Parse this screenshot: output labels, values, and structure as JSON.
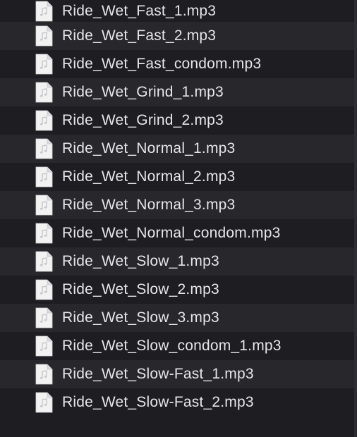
{
  "files": [
    {
      "name": "Ride_Wet_Fast_1.mp3",
      "icon": "audio-file-icon"
    },
    {
      "name": "Ride_Wet_Fast_2.mp3",
      "icon": "audio-file-icon"
    },
    {
      "name": "Ride_Wet_Fast_condom.mp3",
      "icon": "audio-file-icon"
    },
    {
      "name": "Ride_Wet_Grind_1.mp3",
      "icon": "audio-file-icon"
    },
    {
      "name": "Ride_Wet_Grind_2.mp3",
      "icon": "audio-file-icon"
    },
    {
      "name": "Ride_Wet_Normal_1.mp3",
      "icon": "audio-file-icon"
    },
    {
      "name": "Ride_Wet_Normal_2.mp3",
      "icon": "audio-file-icon"
    },
    {
      "name": "Ride_Wet_Normal_3.mp3",
      "icon": "audio-file-icon"
    },
    {
      "name": "Ride_Wet_Normal_condom.mp3",
      "icon": "audio-file-icon"
    },
    {
      "name": "Ride_Wet_Slow_1.mp3",
      "icon": "audio-file-icon"
    },
    {
      "name": "Ride_Wet_Slow_2.mp3",
      "icon": "audio-file-icon"
    },
    {
      "name": "Ride_Wet_Slow_3.mp3",
      "icon": "audio-file-icon"
    },
    {
      "name": "Ride_Wet_Slow_condom_1.mp3",
      "icon": "audio-file-icon"
    },
    {
      "name": "Ride_Wet_Slow-Fast_1.mp3",
      "icon": "audio-file-icon"
    },
    {
      "name": "Ride_Wet_Slow-Fast_2.mp3",
      "icon": "audio-file-icon"
    }
  ],
  "colors": {
    "background": "#1e1e22",
    "row_alt": "#27272c",
    "text": "#e6e6e9",
    "icon_page": "#f2f2f2",
    "icon_note": "#c8c8cc"
  }
}
